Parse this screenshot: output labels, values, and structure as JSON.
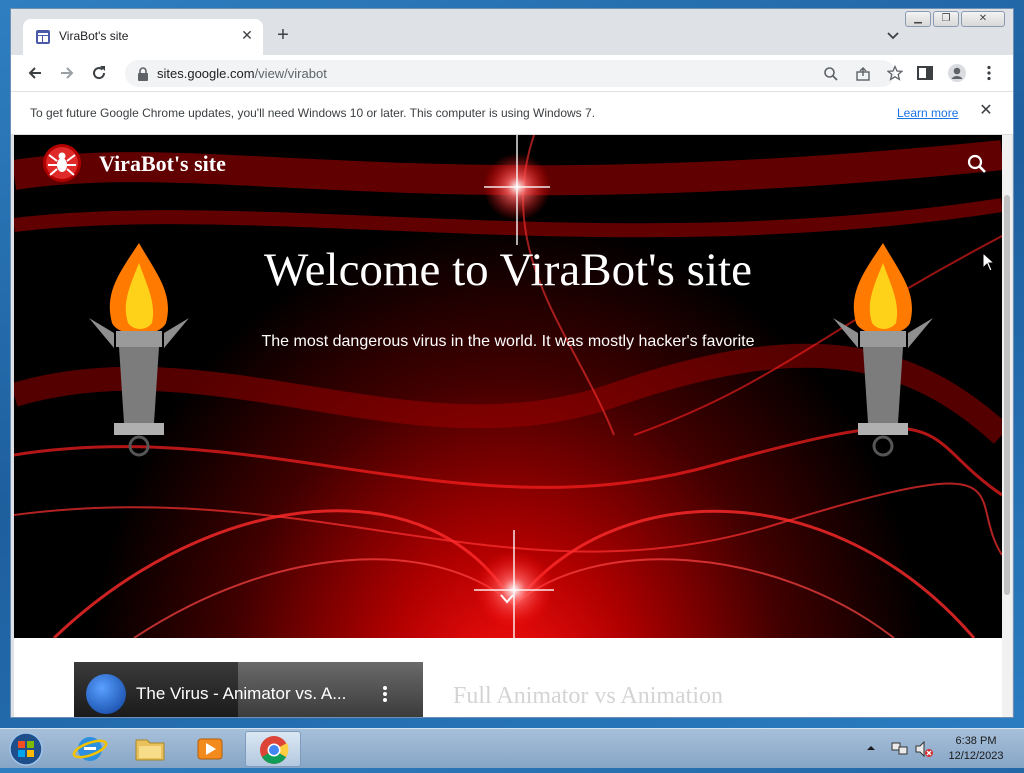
{
  "browser": {
    "tab_title": "ViraBot's site",
    "url_domain": "sites.google.com",
    "url_path": "/view/virabot",
    "infobar_message": "To get future Google Chrome updates, you'll need Windows 10 or later. This computer is using Windows 7.",
    "infobar_link": "Learn more"
  },
  "site": {
    "title": "ViraBot's site",
    "hero_heading": "Welcome to ViraBot's site",
    "hero_subtitle": "The most dangerous virus in the world. It was mostly hacker's favorite",
    "video_title": "The Virus - Animator vs. A...",
    "section_caption": "Full Animator vs Animation"
  },
  "taskbar": {
    "time": "6:38 PM",
    "date": "12/12/2023"
  },
  "colors": {
    "chrome_frame": "#dee1e6",
    "link": "#1a73e8",
    "hero_red": "#d00000"
  }
}
